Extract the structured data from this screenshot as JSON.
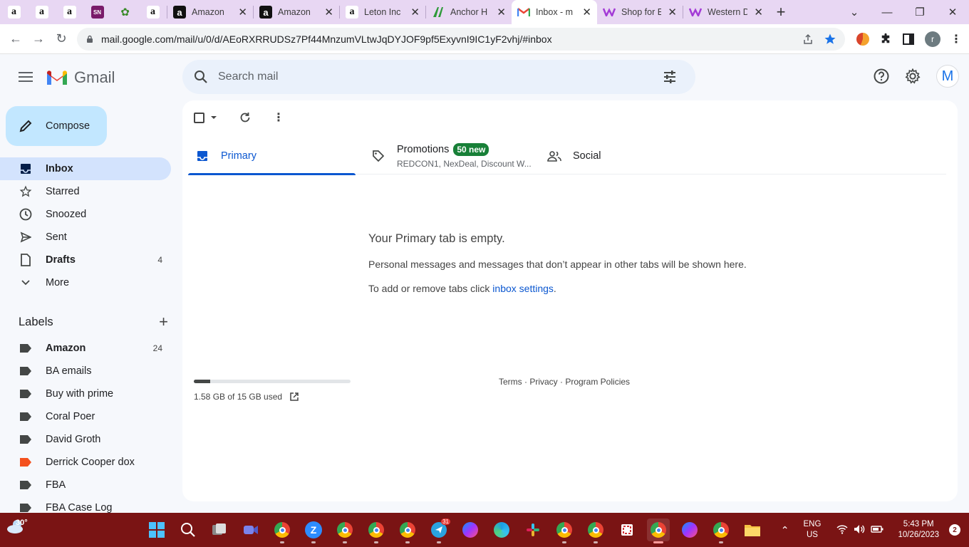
{
  "browser": {
    "pinned_tabs": [
      "amazon",
      "amazon",
      "amazon",
      "sn",
      "leaf",
      "amazon"
    ],
    "pinned_sn_label": "SN",
    "pinned_amz_glyph": "a",
    "tabs": [
      {
        "title": "Amazon",
        "icon": "amazon-dark"
      },
      {
        "title": "Amazon",
        "icon": "amazon-dark"
      },
      {
        "title": "Leton Inc",
        "icon": "amazon"
      },
      {
        "title": "Anchor H",
        "icon": "anchor"
      },
      {
        "title": "Inbox - m",
        "icon": "gmail",
        "active": true
      },
      {
        "title": "Shop for E",
        "icon": "wish"
      },
      {
        "title": "Western D",
        "icon": "wish"
      }
    ],
    "new_tab": "+",
    "close_glyph": "✕",
    "url_host": "mail.google.com",
    "url_path": "/mail/u/0/d/AEoRXRRUDSz7Pf44MnzumVLtwJqDYJOF9pf5ExyvnI9IC1yF2vhj/#inbox",
    "profile_initial": "r"
  },
  "gmail": {
    "wordmark": "Gmail",
    "search_placeholder": "Search mail",
    "avatar_initial": "M",
    "compose": "Compose",
    "nav": [
      {
        "label": "Inbox",
        "icon": "inbox-icon",
        "active": true,
        "count": ""
      },
      {
        "label": "Starred",
        "icon": "star-icon",
        "count": ""
      },
      {
        "label": "Snoozed",
        "icon": "clock-icon",
        "count": ""
      },
      {
        "label": "Sent",
        "icon": "send-icon",
        "count": ""
      },
      {
        "label": "Drafts",
        "icon": "draft-icon",
        "bold": true,
        "count": "4"
      },
      {
        "label": "More",
        "icon": "chevron-down-icon",
        "count": ""
      }
    ],
    "labels_title": "Labels",
    "labels_add": "+",
    "labels": [
      {
        "label": "Amazon",
        "bold": true,
        "count": "24",
        "color": "#444746"
      },
      {
        "label": "BA emails",
        "count": "",
        "color": "#444746"
      },
      {
        "label": "Buy with prime",
        "count": "",
        "color": "#444746"
      },
      {
        "label": "Coral Poer",
        "count": "",
        "color": "#444746"
      },
      {
        "label": "David Groth",
        "count": "",
        "color": "#444746"
      },
      {
        "label": "Derrick Cooper dox",
        "count": "",
        "color": "#f4511e"
      },
      {
        "label": "FBA",
        "count": "",
        "color": "#444746"
      },
      {
        "label": "FBA Case Log",
        "count": "",
        "color": "#444746"
      }
    ],
    "tabs": {
      "primary": "Primary",
      "promotions": "Promotions",
      "promotions_badge": "50 new",
      "promotions_senders": "REDCON1, NexDeal, Discount W...",
      "social": "Social"
    },
    "empty": {
      "heading": "Your Primary tab is empty.",
      "line1": "Personal messages and messages that don’t appear in other tabs will be shown here.",
      "line2_prefix": "To add or remove tabs click ",
      "line2_link": "inbox settings",
      "line2_suffix": "."
    },
    "storage": {
      "text": "1.58 GB of 15 GB used",
      "fraction": 0.105
    },
    "footer": "Terms · Privacy · Program Policies"
  },
  "taskbar": {
    "weather_temp": "30°",
    "lang_top": "ENG",
    "lang_bottom": "US",
    "time": "5:43 PM",
    "date": "10/26/2023",
    "notifications": "2",
    "telegram_badge": "31"
  },
  "colors": {
    "accent": "#0b57d0",
    "compose_bg": "#c2e7ff",
    "active_nav": "#d3e3fd",
    "badge_green": "#188038",
    "tabstrip": "#e8d7f3",
    "taskbar": "#7a1414"
  }
}
